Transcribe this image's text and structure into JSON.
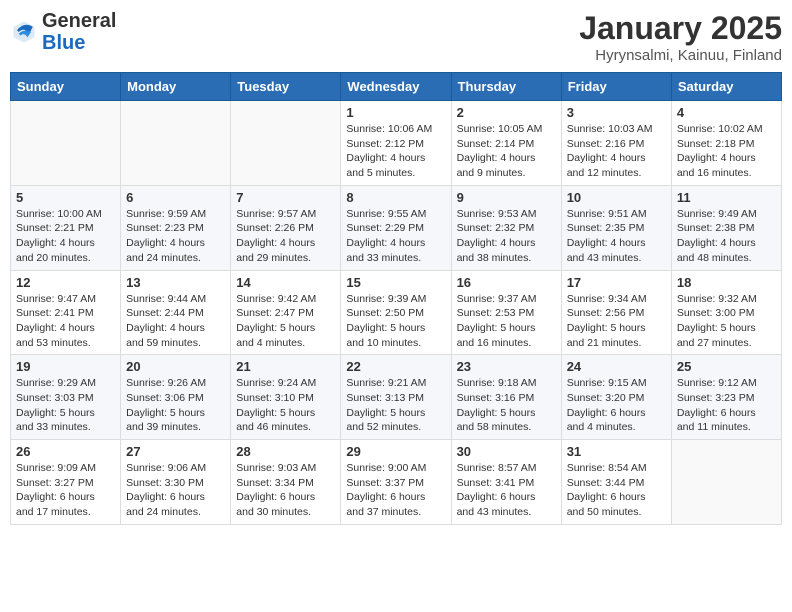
{
  "header": {
    "logo_general": "General",
    "logo_blue": "Blue",
    "month_title": "January 2025",
    "location": "Hyrynsalmi, Kainuu, Finland"
  },
  "weekdays": [
    "Sunday",
    "Monday",
    "Tuesday",
    "Wednesday",
    "Thursday",
    "Friday",
    "Saturday"
  ],
  "weeks": [
    [
      {
        "day": "",
        "info": ""
      },
      {
        "day": "",
        "info": ""
      },
      {
        "day": "",
        "info": ""
      },
      {
        "day": "1",
        "info": "Sunrise: 10:06 AM\nSunset: 2:12 PM\nDaylight: 4 hours\nand 5 minutes."
      },
      {
        "day": "2",
        "info": "Sunrise: 10:05 AM\nSunset: 2:14 PM\nDaylight: 4 hours\nand 9 minutes."
      },
      {
        "day": "3",
        "info": "Sunrise: 10:03 AM\nSunset: 2:16 PM\nDaylight: 4 hours\nand 12 minutes."
      },
      {
        "day": "4",
        "info": "Sunrise: 10:02 AM\nSunset: 2:18 PM\nDaylight: 4 hours\nand 16 minutes."
      }
    ],
    [
      {
        "day": "5",
        "info": "Sunrise: 10:00 AM\nSunset: 2:21 PM\nDaylight: 4 hours\nand 20 minutes."
      },
      {
        "day": "6",
        "info": "Sunrise: 9:59 AM\nSunset: 2:23 PM\nDaylight: 4 hours\nand 24 minutes."
      },
      {
        "day": "7",
        "info": "Sunrise: 9:57 AM\nSunset: 2:26 PM\nDaylight: 4 hours\nand 29 minutes."
      },
      {
        "day": "8",
        "info": "Sunrise: 9:55 AM\nSunset: 2:29 PM\nDaylight: 4 hours\nand 33 minutes."
      },
      {
        "day": "9",
        "info": "Sunrise: 9:53 AM\nSunset: 2:32 PM\nDaylight: 4 hours\nand 38 minutes."
      },
      {
        "day": "10",
        "info": "Sunrise: 9:51 AM\nSunset: 2:35 PM\nDaylight: 4 hours\nand 43 minutes."
      },
      {
        "day": "11",
        "info": "Sunrise: 9:49 AM\nSunset: 2:38 PM\nDaylight: 4 hours\nand 48 minutes."
      }
    ],
    [
      {
        "day": "12",
        "info": "Sunrise: 9:47 AM\nSunset: 2:41 PM\nDaylight: 4 hours\nand 53 minutes."
      },
      {
        "day": "13",
        "info": "Sunrise: 9:44 AM\nSunset: 2:44 PM\nDaylight: 4 hours\nand 59 minutes."
      },
      {
        "day": "14",
        "info": "Sunrise: 9:42 AM\nSunset: 2:47 PM\nDaylight: 5 hours\nand 4 minutes."
      },
      {
        "day": "15",
        "info": "Sunrise: 9:39 AM\nSunset: 2:50 PM\nDaylight: 5 hours\nand 10 minutes."
      },
      {
        "day": "16",
        "info": "Sunrise: 9:37 AM\nSunset: 2:53 PM\nDaylight: 5 hours\nand 16 minutes."
      },
      {
        "day": "17",
        "info": "Sunrise: 9:34 AM\nSunset: 2:56 PM\nDaylight: 5 hours\nand 21 minutes."
      },
      {
        "day": "18",
        "info": "Sunrise: 9:32 AM\nSunset: 3:00 PM\nDaylight: 5 hours\nand 27 minutes."
      }
    ],
    [
      {
        "day": "19",
        "info": "Sunrise: 9:29 AM\nSunset: 3:03 PM\nDaylight: 5 hours\nand 33 minutes."
      },
      {
        "day": "20",
        "info": "Sunrise: 9:26 AM\nSunset: 3:06 PM\nDaylight: 5 hours\nand 39 minutes."
      },
      {
        "day": "21",
        "info": "Sunrise: 9:24 AM\nSunset: 3:10 PM\nDaylight: 5 hours\nand 46 minutes."
      },
      {
        "day": "22",
        "info": "Sunrise: 9:21 AM\nSunset: 3:13 PM\nDaylight: 5 hours\nand 52 minutes."
      },
      {
        "day": "23",
        "info": "Sunrise: 9:18 AM\nSunset: 3:16 PM\nDaylight: 5 hours\nand 58 minutes."
      },
      {
        "day": "24",
        "info": "Sunrise: 9:15 AM\nSunset: 3:20 PM\nDaylight: 6 hours\nand 4 minutes."
      },
      {
        "day": "25",
        "info": "Sunrise: 9:12 AM\nSunset: 3:23 PM\nDaylight: 6 hours\nand 11 minutes."
      }
    ],
    [
      {
        "day": "26",
        "info": "Sunrise: 9:09 AM\nSunset: 3:27 PM\nDaylight: 6 hours\nand 17 minutes."
      },
      {
        "day": "27",
        "info": "Sunrise: 9:06 AM\nSunset: 3:30 PM\nDaylight: 6 hours\nand 24 minutes."
      },
      {
        "day": "28",
        "info": "Sunrise: 9:03 AM\nSunset: 3:34 PM\nDaylight: 6 hours\nand 30 minutes."
      },
      {
        "day": "29",
        "info": "Sunrise: 9:00 AM\nSunset: 3:37 PM\nDaylight: 6 hours\nand 37 minutes."
      },
      {
        "day": "30",
        "info": "Sunrise: 8:57 AM\nSunset: 3:41 PM\nDaylight: 6 hours\nand 43 minutes."
      },
      {
        "day": "31",
        "info": "Sunrise: 8:54 AM\nSunset: 3:44 PM\nDaylight: 6 hours\nand 50 minutes."
      },
      {
        "day": "",
        "info": ""
      }
    ]
  ]
}
